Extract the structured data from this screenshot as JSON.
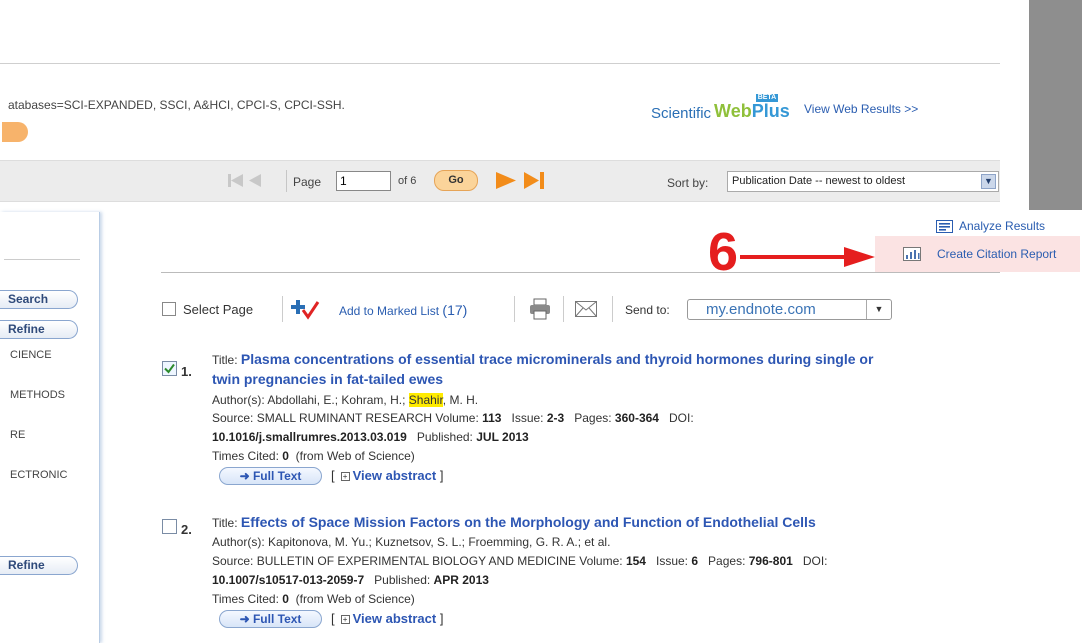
{
  "header": {
    "databases_text": "atabases=SCI-EXPANDED, SSCI, A&HCI, CPCI-S, CPCI-SSH.",
    "logo": {
      "scientific": "Scientific",
      "web": "Web",
      "plus": "Plus",
      "beta": "BETA"
    },
    "view_web_results": "View Web Results >>"
  },
  "pagination": {
    "page_label": "Page",
    "page_value": "1",
    "of_label": "of 6",
    "go_label": "Go",
    "sort_label": "Sort by:",
    "sort_value": "Publication Date -- newest to oldest"
  },
  "sidebar": {
    "search_button": "Search",
    "refine_button": "Refine",
    "items": [
      "CIENCE",
      "METHODS",
      "RE",
      "ECTRONIC"
    ],
    "refine_button_bottom": "Refine"
  },
  "actions": {
    "analyze_results": "Analyze Results",
    "create_citation_report": "Create Citation Report",
    "annotation_number": "6"
  },
  "toolbar": {
    "select_page": "Select Page",
    "add_to_marked_list": "Add to Marked List",
    "marked_count": "(17)",
    "send_to_label": "Send to:",
    "send_to_value": "my.endnote.com"
  },
  "records": [
    {
      "number": "1.",
      "checked": true,
      "title_label": "Title:",
      "title_line1": "Plasma concentrations of essential trace microminerals and thyroid hormones during single or",
      "title_line2": "twin pregnancies in fat-tailed ewes",
      "authors_prefix": "Author(s): Abdollahi, E.; Kohram, H.; ",
      "authors_highlight": "Shahir",
      "authors_suffix": ", M. H.",
      "source_label": "Source:",
      "source_journal": "SMALL RUMINANT RESEARCH",
      "volume_label": "Volume:",
      "volume": "113",
      "issue_label": "Issue:",
      "issue": "2-3",
      "pages_label": "Pages:",
      "pages": "360-364",
      "doi_label": "DOI:",
      "doi": "10.1016/j.smallrumres.2013.03.019",
      "published_label": "Published:",
      "published": "JUL 2013",
      "times_cited_label": "Times Cited:",
      "times_cited": "0",
      "times_cited_source": "(from Web of Science)",
      "full_text": "Full Text",
      "view_abstract": "View abstract"
    },
    {
      "number": "2.",
      "checked": false,
      "title_label": "Title:",
      "title_line1": "Effects of Space Mission Factors on the Morphology and Function of Endothelial Cells",
      "authors": "Author(s): Kapitonova, M. Yu.; Kuznetsov, S. L.; Froemming, G. R. A.; et al.",
      "source_label": "Source:",
      "source_journal": "BULLETIN OF EXPERIMENTAL BIOLOGY AND MEDICINE",
      "volume_label": "Volume:",
      "volume": "154",
      "issue_label": "Issue:",
      "issue": "6",
      "pages_label": "Pages:",
      "pages": "796-801",
      "doi_label": "DOI:",
      "doi": "10.1007/s10517-013-2059-7",
      "published_label": "Published:",
      "published": "APR 2013",
      "times_cited_label": "Times Cited:",
      "times_cited": "0",
      "times_cited_source": "(from Web of Science)",
      "full_text": "Full Text",
      "view_abstract": "View abstract"
    }
  ],
  "colors": {
    "link": "#2a5db0",
    "title_link": "#2d56b3",
    "annotation_red": "#e51e1e",
    "highlight": "#ffeb00",
    "go_button": "#fbd49a",
    "citation_highlight": "#fbe3e3"
  },
  "icons": [
    "first-page-icon",
    "prev-page-icon",
    "next-page-icon",
    "last-page-icon",
    "add-to-marked-list-icon",
    "print-icon",
    "email-icon",
    "analyze-icon",
    "citation-report-icon",
    "arrow-right-icon",
    "plus-box-icon",
    "dropdown-arrow-icon"
  ]
}
